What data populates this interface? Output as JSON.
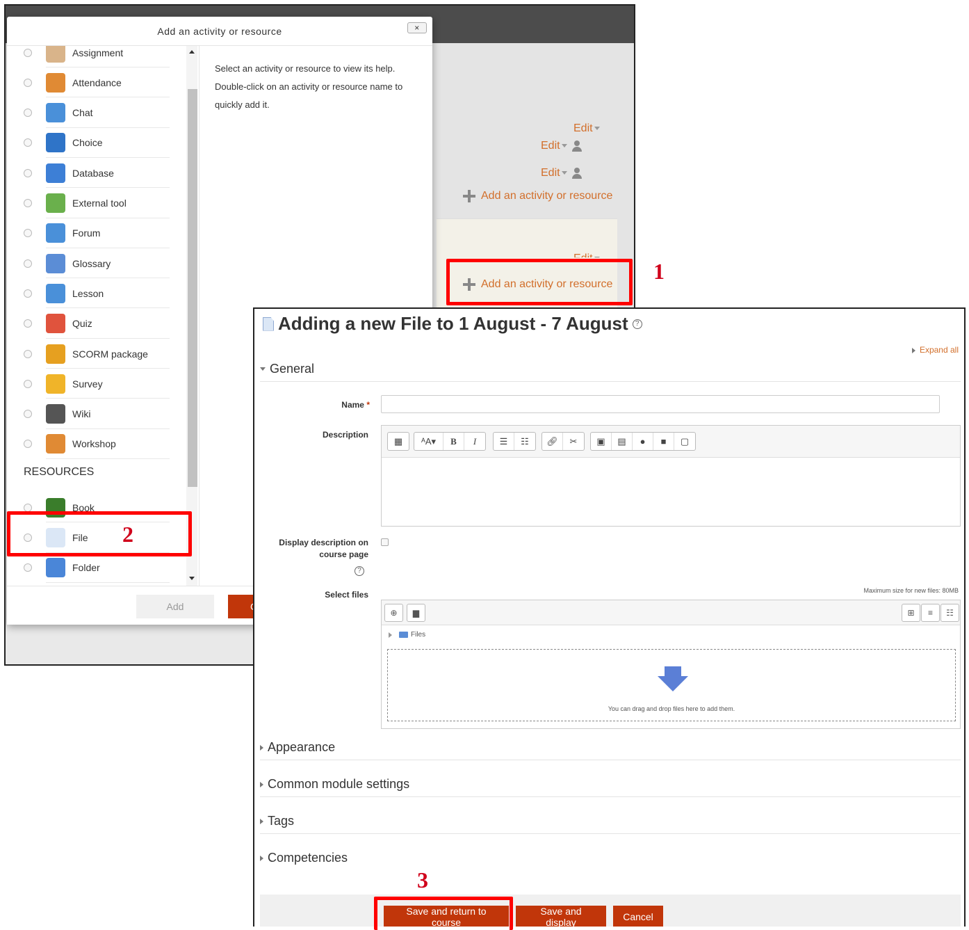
{
  "course_page": {
    "edit_labels": [
      "Edit",
      "Edit",
      "Edit",
      "Edit"
    ],
    "add_activity_label": "Add an activity or resource",
    "add_activity_label_2": "Add an activity or resource"
  },
  "modal": {
    "title": "Add an activity or resource",
    "close_label": "×",
    "activities": [
      {
        "label": "Assignment",
        "icon": "assignment-icon",
        "color": "#d9b48a"
      },
      {
        "label": "Attendance",
        "icon": "attendance-icon",
        "color": "#e08a34"
      },
      {
        "label": "Chat",
        "icon": "chat-icon",
        "color": "#4a90d9"
      },
      {
        "label": "Choice",
        "icon": "choice-icon",
        "color": "#2f74c8"
      },
      {
        "label": "Database",
        "icon": "database-icon",
        "color": "#3d7fd6"
      },
      {
        "label": "External tool",
        "icon": "puzzle-icon",
        "color": "#6ab04c"
      },
      {
        "label": "Forum",
        "icon": "forum-icon",
        "color": "#4a90d9"
      },
      {
        "label": "Glossary",
        "icon": "glossary-icon",
        "color": "#5b8dd6"
      },
      {
        "label": "Lesson",
        "icon": "lesson-icon",
        "color": "#4a90d9"
      },
      {
        "label": "Quiz",
        "icon": "quiz-icon",
        "color": "#e0533d"
      },
      {
        "label": "SCORM package",
        "icon": "scorm-icon",
        "color": "#e6a020"
      },
      {
        "label": "Survey",
        "icon": "survey-icon",
        "color": "#f0b429"
      },
      {
        "label": "Wiki",
        "icon": "wiki-icon",
        "color": "#555555"
      },
      {
        "label": "Workshop",
        "icon": "workshop-icon",
        "color": "#e08a34"
      }
    ],
    "resources_heading": "RESOURCES",
    "resources": [
      {
        "label": "Book",
        "icon": "book-icon",
        "color": "#3a7d2b"
      },
      {
        "label": "File",
        "icon": "file-icon",
        "color": "#dbe7f6"
      },
      {
        "label": "Folder",
        "icon": "folder-icon",
        "color": "#4a86d8"
      }
    ],
    "help_text": "Select an activity or resource to view its help. Double-click on an activity or resource name to quickly add it.",
    "add_button": "Add",
    "cancel_button": "C"
  },
  "annotations": {
    "one": "1",
    "two": "2",
    "three": "3"
  },
  "form": {
    "title": "Adding a new File to 1 August - 7 August",
    "help_glyph": "?",
    "expand_all": "Expand all",
    "general_heading": "General",
    "name_label": "Name",
    "required_mark": "*",
    "description_label": "Description",
    "display_desc_label_1": "Display description on",
    "display_desc_label_2": "course page",
    "select_files_label": "Select files",
    "max_size": "Maximum size for new files: 80MB",
    "files_path": "Files",
    "drop_text": "You can drag and drop files here to add them.",
    "sections": [
      "Appearance",
      "Common module settings",
      "Tags",
      "Competencies"
    ],
    "save_return": "Save and return to course",
    "save_display": "Save and display",
    "cancel": "Cancel",
    "colors": {
      "accent": "#d26f2b",
      "button": "#c1360a",
      "annotation": "#ff0000"
    }
  }
}
